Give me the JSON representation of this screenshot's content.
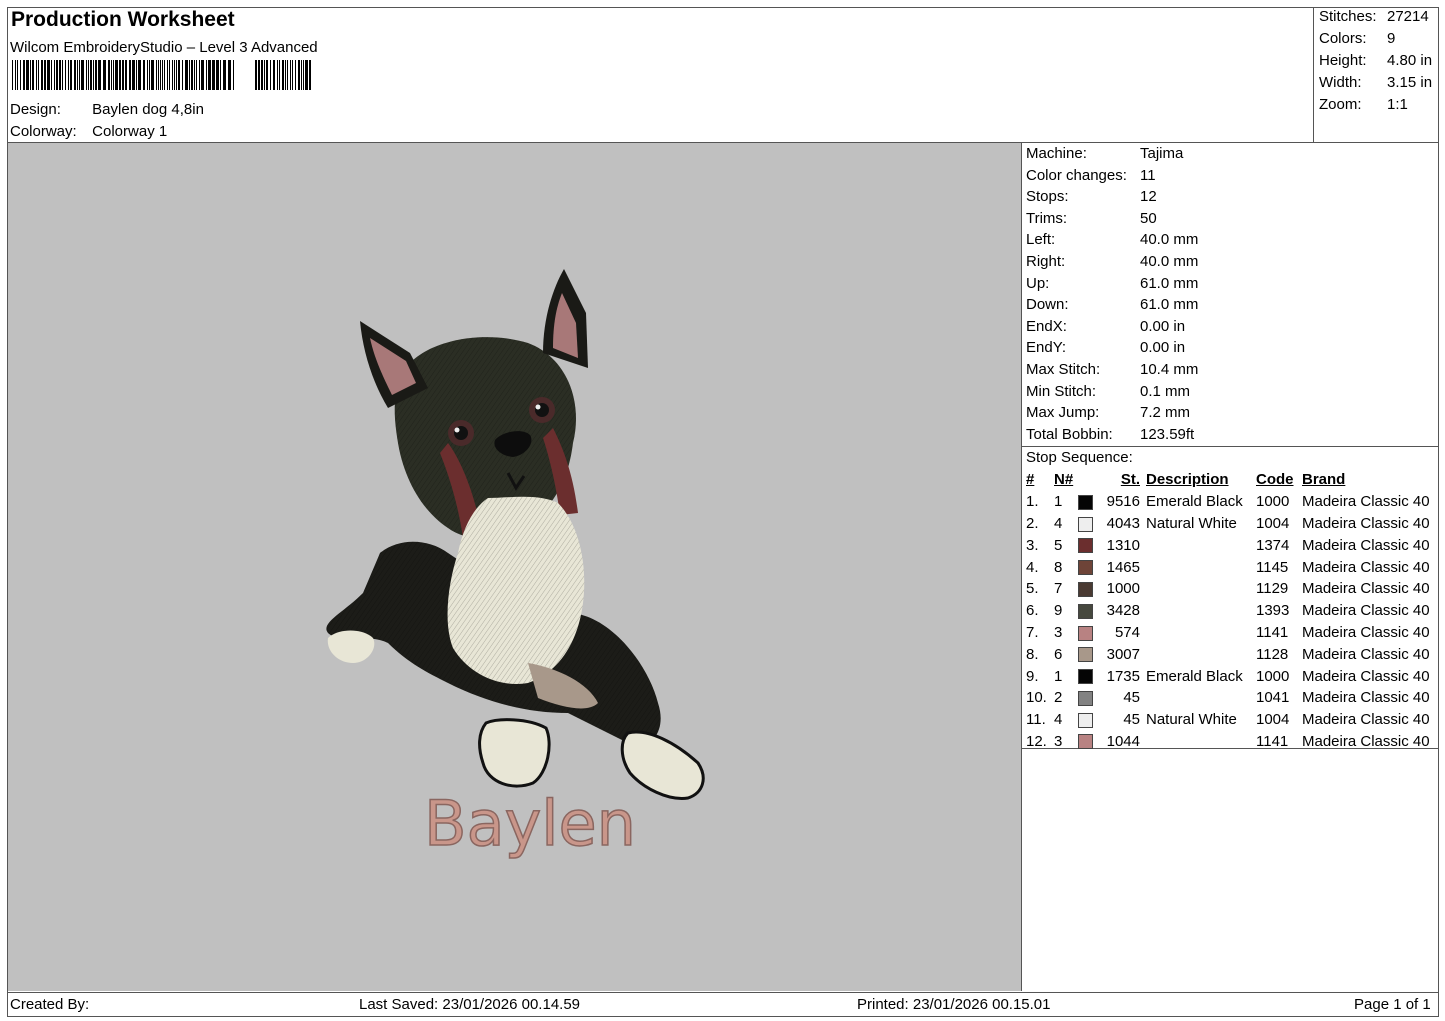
{
  "header": {
    "title": "Production Worksheet",
    "software": "Wilcom EmbroideryStudio – Level 3 Advanced",
    "design_label": "Design:",
    "design_value": "Baylen dog 4,8in",
    "colorway_label": "Colorway:",
    "colorway_value": "Colorway 1"
  },
  "stats": [
    {
      "label": "Stitches:",
      "value": "27214"
    },
    {
      "label": "Colors:",
      "value": "9"
    },
    {
      "label": "Height:",
      "value": "4.80 in"
    },
    {
      "label": "Width:",
      "value": "3.15 in"
    },
    {
      "label": "Zoom:",
      "value": "1:1"
    }
  ],
  "machine_info": [
    {
      "label": "Machine:",
      "value": "Tajima"
    },
    {
      "label": "Color changes:",
      "value": "11"
    },
    {
      "label": "Stops:",
      "value": "12"
    },
    {
      "label": "Trims:",
      "value": "50"
    },
    {
      "label": "Left:",
      "value": "40.0 mm"
    },
    {
      "label": "Right:",
      "value": "40.0 mm"
    },
    {
      "label": "Up:",
      "value": "61.0 mm"
    },
    {
      "label": "Down:",
      "value": "61.0 mm"
    },
    {
      "label": "EndX:",
      "value": "0.00 in"
    },
    {
      "label": "EndY:",
      "value": "0.00 in"
    },
    {
      "label": "Max Stitch:",
      "value": "10.4 mm"
    },
    {
      "label": "Min Stitch:",
      "value": "0.1 mm"
    },
    {
      "label": "Max Jump:",
      "value": "7.2 mm"
    },
    {
      "label": "Total Bobbin:",
      "value": "123.59ft"
    }
  ],
  "stop_sequence": {
    "title": "Stop Sequence:",
    "columns": [
      "#",
      "N#",
      "St.",
      "Description",
      "Code",
      "Brand"
    ],
    "rows": [
      {
        "idx": "1.",
        "n": "1",
        "color": "#050505",
        "st": "9516",
        "desc": "Emerald Black",
        "code": "1000",
        "brand": "Madeira Classic 40"
      },
      {
        "idx": "2.",
        "n": "4",
        "color": "#eeeeee",
        "st": "4043",
        "desc": "Natural White",
        "code": "1004",
        "brand": "Madeira Classic 40"
      },
      {
        "idx": "3.",
        "n": "5",
        "color": "#6b2e2e",
        "st": "1310",
        "desc": "",
        "code": "1374",
        "brand": "Madeira Classic 40"
      },
      {
        "idx": "4.",
        "n": "8",
        "color": "#6e4438",
        "st": "1465",
        "desc": "",
        "code": "1145",
        "brand": "Madeira Classic 40"
      },
      {
        "idx": "5.",
        "n": "7",
        "color": "#4a3a32",
        "st": "1000",
        "desc": "",
        "code": "1129",
        "brand": "Madeira Classic 40"
      },
      {
        "idx": "6.",
        "n": "9",
        "color": "#46483e",
        "st": "3428",
        "desc": "",
        "code": "1393",
        "brand": "Madeira Classic 40"
      },
      {
        "idx": "7.",
        "n": "3",
        "color": "#b88282",
        "st": "574",
        "desc": "",
        "code": "1141",
        "brand": "Madeira Classic 40"
      },
      {
        "idx": "8.",
        "n": "6",
        "color": "#a8988a",
        "st": "3007",
        "desc": "",
        "code": "1128",
        "brand": "Madeira Classic 40"
      },
      {
        "idx": "9.",
        "n": "1",
        "color": "#050505",
        "st": "1735",
        "desc": "Emerald Black",
        "code": "1000",
        "brand": "Madeira Classic 40"
      },
      {
        "idx": "10.",
        "n": "2",
        "color": "#828282",
        "st": "45",
        "desc": "",
        "code": "1041",
        "brand": "Madeira Classic 40"
      },
      {
        "idx": "11.",
        "n": "4",
        "color": "#eeeeee",
        "st": "45",
        "desc": "Natural White",
        "code": "1004",
        "brand": "Madeira Classic 40"
      },
      {
        "idx": "12.",
        "n": "3",
        "color": "#b88282",
        "st": "1044",
        "desc": "",
        "code": "1141",
        "brand": "Madeira Classic 40"
      }
    ]
  },
  "design_preview": {
    "name_text": "Baylen",
    "background": "#c0c0c0",
    "text_color": "#c9968a"
  },
  "footer": {
    "created_by": "Created By:",
    "last_saved": "Last Saved: 23/01/2026 00.14.59",
    "printed": "Printed: 23/01/2026 00.15.01",
    "page": "Page 1 of 1"
  }
}
